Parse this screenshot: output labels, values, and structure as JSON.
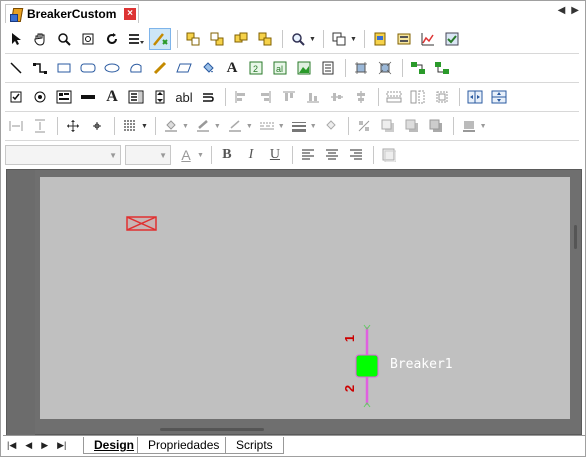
{
  "window": {
    "title": "BreakerCustom",
    "close_glyph": "×",
    "nav_left": "◀",
    "nav_right": "▶"
  },
  "toolbar1": {
    "icons": [
      "pointer-icon",
      "hand-icon",
      "zoom-icon",
      "fit-icon",
      "refresh-icon",
      "grid-list-icon",
      "connect-tool-icon",
      "bring-front-icon",
      "send-back-icon",
      "group-icon",
      "ungroup-icon",
      "magnifier-icon",
      "layer-icon",
      "properties-icon",
      "image-icon",
      "chart-icon",
      "check-icon"
    ]
  },
  "toolbar2": {
    "text_tool_label": "A"
  },
  "toolbar3": {
    "text_label": "A",
    "abl_label": "abl"
  },
  "font_row": {
    "font_name": "",
    "font_size": "",
    "font_color_label": "A",
    "bold": "B",
    "italic": "I",
    "underline": "U"
  },
  "canvas": {
    "component_label": "Breaker1",
    "pin_top": "1",
    "pin_bottom": "2",
    "colors": {
      "page": "#c0c0c0",
      "breaker_body": "#00ff00",
      "pin_line": "#e060e0",
      "pin_label": "#cc0000",
      "label_text": "#ffffff",
      "placeholder": "#e03030"
    }
  },
  "bottom_tabs": {
    "pager": [
      "|◀",
      "◀",
      "▶",
      "▶|"
    ],
    "tabs": [
      "Design",
      "Propriedades",
      "Scripts"
    ],
    "active": "Design"
  }
}
